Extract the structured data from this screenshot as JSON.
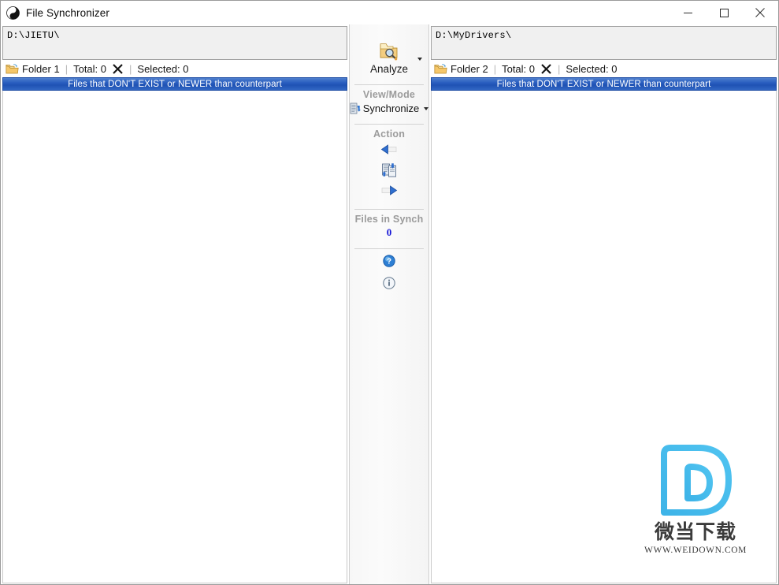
{
  "window": {
    "title": "File Synchronizer",
    "app_icon": "yinyang-icon",
    "controls": {
      "minimize": "minimize-icon",
      "maximize": "maximize-icon",
      "close": "close-icon"
    }
  },
  "left_pane": {
    "path_value": "D:\\JIETU\\",
    "path_placeholder": "",
    "folder_label": "Folder 1",
    "total_label": "Total: 0",
    "clear_icon": "clear-x-icon",
    "selected_label": "Selected: 0",
    "column_header": "Files that DON'T EXIST or NEWER than counterpart"
  },
  "right_pane": {
    "path_value": "D:\\MyDrivers\\",
    "path_placeholder": "",
    "folder_label": "Folder 2",
    "total_label": "Total: 0",
    "clear_icon": "clear-x-icon",
    "selected_label": "Selected: 0",
    "column_header": "Files that DON'T EXIST or NEWER than counterpart"
  },
  "center": {
    "analyze_label": "Analyze",
    "analyze_icon": "folder-search-icon",
    "analyze_dropdown_icon": "caret-down-icon",
    "view_mode_label": "View/Mode",
    "synchronize_label": "Synchronize",
    "synchronize_icon": "synchronize-icon",
    "synchronize_dropdown_icon": "caret-down-icon",
    "action_label": "Action",
    "copy_left_icon": "arrow-left-icon",
    "sync_both_icon": "sync-documents-icon",
    "copy_right_icon": "arrow-right-icon",
    "files_in_synch_label": "Files in Synch",
    "files_in_synch_value": "0",
    "help_icon": "help-question-icon",
    "info_icon": "info-circle-icon"
  },
  "watermark": {
    "logo_letter": "D",
    "name_cn": "微当下载",
    "url": "WWW.WEIDOWN.COM"
  },
  "colors": {
    "header_blue_top": "#4e7fcd",
    "header_blue_bottom": "#1f52b4",
    "accent_count_blue": "#1414d6",
    "section_label_gray": "#9b9b9b",
    "watermark_blue": "#3fb6e8"
  }
}
